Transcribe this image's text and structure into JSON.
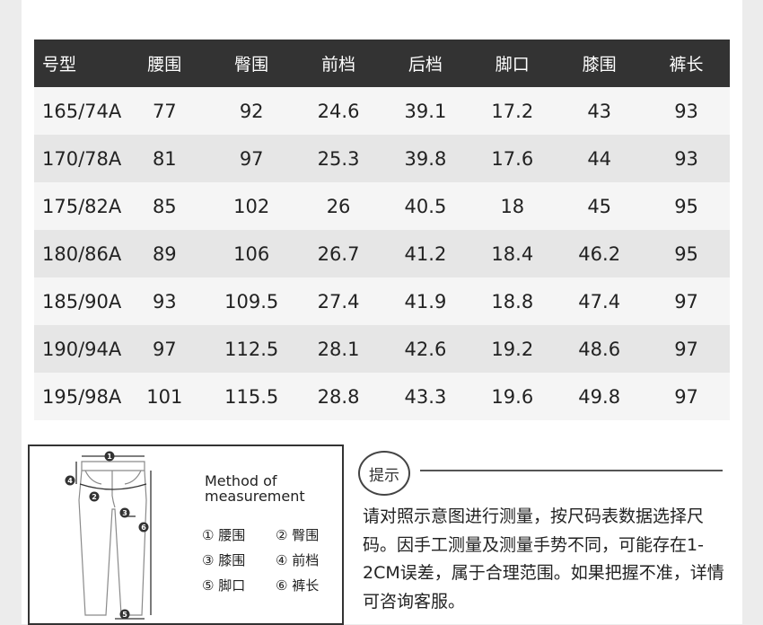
{
  "table": {
    "headers": [
      "号型",
      "腰围",
      "臀围",
      "前档",
      "后档",
      "脚口",
      "膝围",
      "裤长"
    ],
    "rows": [
      [
        "165/74A",
        "77",
        "92",
        "24.6",
        "39.1",
        "17.2",
        "43",
        "93"
      ],
      [
        "170/78A",
        "81",
        "97",
        "25.3",
        "39.8",
        "17.6",
        "44",
        "93"
      ],
      [
        "175/82A",
        "85",
        "102",
        "26",
        "40.5",
        "18",
        "45",
        "95"
      ],
      [
        "180/86A",
        "89",
        "106",
        "26.7",
        "41.2",
        "18.4",
        "46.2",
        "95"
      ],
      [
        "185/90A",
        "93",
        "109.5",
        "27.4",
        "41.9",
        "18.8",
        "47.4",
        "97"
      ],
      [
        "190/94A",
        "97",
        "112.5",
        "28.1",
        "42.6",
        "19.2",
        "48.6",
        "97"
      ],
      [
        "195/98A",
        "101",
        "115.5",
        "28.8",
        "43.3",
        "19.6",
        "49.8",
        "97"
      ]
    ]
  },
  "diagram": {
    "title_line1": "Method of",
    "title_line2": "measurement",
    "markers": [
      "1",
      "2",
      "3",
      "4",
      "5",
      "6"
    ],
    "legend": [
      "① 腰围",
      "② 臀围",
      "③ 膝围",
      "④ 前档",
      "⑤ 脚口",
      "⑥ 裤长"
    ]
  },
  "tip": {
    "badge": "提示",
    "text": "请对照示意图进行测量，按尺码表数据选择尺码。因手工测量及测量手势不同，可能存在1-2CM误差，属于合理范围。如果把握不准，详情可咨询客服。"
  },
  "colors": {
    "header_bg": "#333333",
    "row_light": "#f5f5f5",
    "row_dark": "#e6e6e6"
  }
}
